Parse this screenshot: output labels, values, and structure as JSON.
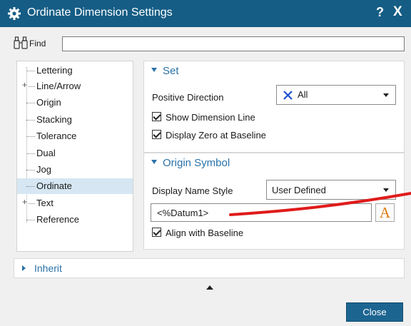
{
  "window": {
    "title": "Ordinate Dimension Settings",
    "help_label": "?",
    "close_label": "X"
  },
  "find": {
    "label": "Find",
    "value": ""
  },
  "tree": {
    "items": [
      {
        "label": "Lettering",
        "expandable": false
      },
      {
        "label": "Line/Arrow",
        "expandable": true
      },
      {
        "label": "Origin",
        "expandable": false
      },
      {
        "label": "Stacking",
        "expandable": false
      },
      {
        "label": "Tolerance",
        "expandable": false
      },
      {
        "label": "Dual",
        "expandable": false
      },
      {
        "label": "Jog",
        "expandable": false
      },
      {
        "label": "Ordinate",
        "expandable": false,
        "selected": true
      },
      {
        "label": "Text",
        "expandable": true
      },
      {
        "label": "Reference",
        "expandable": false
      }
    ],
    "expand_glyph": "+"
  },
  "set_section": {
    "header": "Set",
    "positive_direction_label": "Positive Direction",
    "positive_direction_value": "All",
    "positive_direction_icon": "x-cross-icon",
    "show_dimension_line_label": "Show Dimension Line",
    "show_dimension_line_checked": true,
    "display_zero_label": "Display Zero at Baseline",
    "display_zero_checked": true
  },
  "origin_section": {
    "header": "Origin Symbol",
    "display_name_style_label": "Display Name Style",
    "display_name_style_value": "User Defined",
    "name_value": "<%Datum1>",
    "text_style_glyph": "A",
    "align_baseline_label": "Align with Baseline",
    "align_baseline_checked": true
  },
  "inherit": {
    "label": "Inherit"
  },
  "footer": {
    "close_label": "Close"
  },
  "colors": {
    "titlebar": "#155d85",
    "accent": "#2a72a8",
    "selected_row": "#d6e7f3",
    "annotation_red": "#e01b1b",
    "text_style_icon": "#e07a10"
  }
}
